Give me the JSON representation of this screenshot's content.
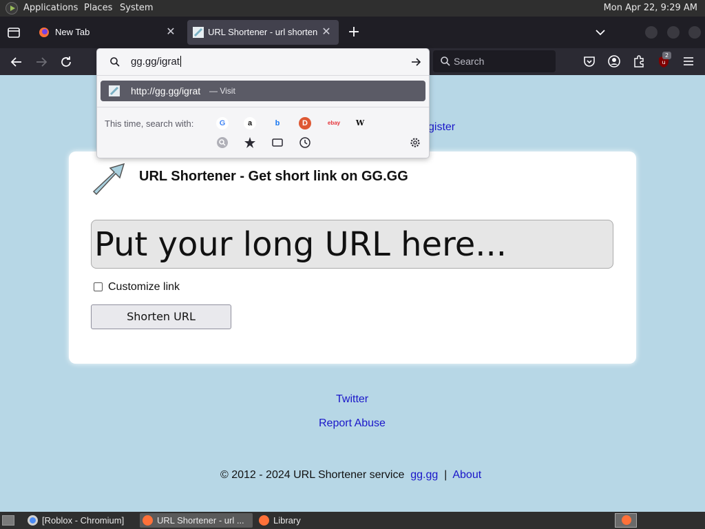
{
  "top_panel": {
    "menus": [
      "Applications",
      "Places",
      "System"
    ],
    "clock": "Mon Apr 22,  9:29 AM"
  },
  "tabs": [
    {
      "title": "New Tab",
      "active": false
    },
    {
      "title": "URL Shortener - url shorten",
      "active": true
    }
  ],
  "toolbar": {
    "search_placeholder": "Search"
  },
  "urlbar": {
    "typed": "gg.gg/igrat",
    "result_url": "http://gg.gg/igrat",
    "result_action": "—  Visit",
    "oneoff_label": "This time, search with:",
    "engines": [
      "Google",
      "Amazon",
      "Bing",
      "DuckDuckGo",
      "eBay",
      "Wikipedia"
    ],
    "ublock_count": "2"
  },
  "page": {
    "register_link": "gister",
    "heading": "URL Shortener - Get short link on GG.GG",
    "url_placeholder": "Put your long URL here...",
    "customize_label": "Customize link",
    "shorten_button": "Shorten URL",
    "twitter_link": "Twitter",
    "report_link": "Report Abuse",
    "copyright": "© 2012 - 2024 URL Shortener service",
    "footer_site": "gg.gg",
    "footer_sep": "|",
    "footer_about": "About"
  },
  "taskbar": {
    "tasks": [
      {
        "label": "[Roblox - Chromium]",
        "active": false
      },
      {
        "label": "URL Shortener - url ...",
        "active": true
      },
      {
        "label": "Library",
        "active": false
      }
    ]
  },
  "colors": {
    "page_bg": "#b7d7e6",
    "link": "#1a16c9",
    "firefox_dark": "#2b2a33",
    "selected_result": "#5b5b66"
  }
}
